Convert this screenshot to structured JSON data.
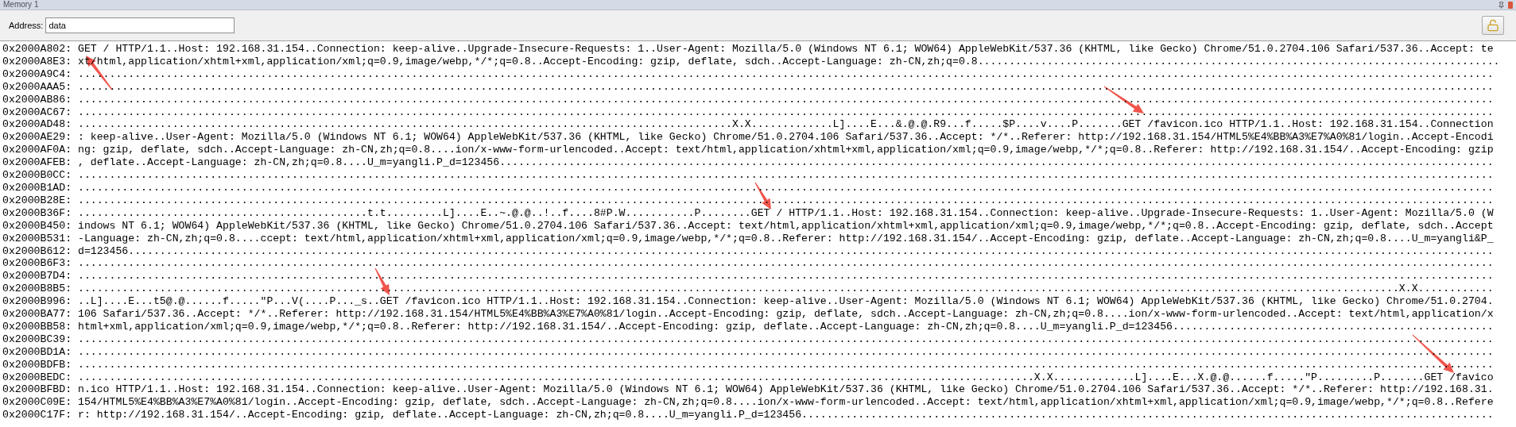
{
  "panel": {
    "title": "Memory 1"
  },
  "address_bar": {
    "label": "Address:",
    "value": "data"
  },
  "rows": [
    {
      "address": "0x2000A802:",
      "text": "GET / HTTP/1.1..Host: 192.168.31.154..Connection: keep-alive..Upgrade-Insecure-Requests: 1..User-Agent: Mozilla/5.0 (Windows NT 6.1; WOW64) AppleWebKit/537.36 (KHTML, like Gecko) Chrome/51.0.2704.106 Safari/537.36..Accept: te"
    },
    {
      "address": "0x2000A8E3:",
      "text": "xt/html,application/xhtml+xml,application/xml;q=0.9,image/webp,*/*;q=0.8..Accept-Encoding: gzip, deflate, sdch..Accept-Language: zh-CN,zh;q=0.8..................................................................................."
    },
    {
      "address": "0x2000A9C4:",
      "text": "................................................................................................................................................................................................................................."
    },
    {
      "address": "0x2000AAA5:",
      "text": "................................................................................................................................................................................................................................."
    },
    {
      "address": "0x2000AB86:",
      "text": "................................................................................................................................................................................................................................."
    },
    {
      "address": "0x2000AC67:",
      "text": "................................................................................................................................................................................................................................."
    },
    {
      "address": "0x2000AD48:",
      "text": "........................................................................................................X.X.............L]....E...&.@.@.R9...f.....$P....v....P.......GET /favicon.ico HTTP/1.1..Host: 192.168.31.154..Connection"
    },
    {
      "address": "0x2000AE29:",
      "text": ": keep-alive..User-Agent: Mozilla/5.0 (Windows NT 6.1; WOW64) AppleWebKit/537.36 (KHTML, like Gecko) Chrome/51.0.2704.106 Safari/537.36..Accept: */*..Referer: http://192.168.31.154/HTML5%E4%BB%A3%E7%A0%81/login..Accept-Encodi"
    },
    {
      "address": "0x2000AF0A:",
      "text": "ng: gzip, deflate, sdch..Accept-Language: zh-CN,zh;q=0.8....ion/x-www-form-urlencoded..Accept: text/html,application/xhtml+xml,application/xml;q=0.9,image/webp,*/*;q=0.8..Referer: http://192.168.31.154/..Accept-Encoding: gzip"
    },
    {
      "address": "0x2000AFEB:",
      "text": ", deflate..Accept-Language: zh-CN,zh;q=0.8....U_m=yangli.P_d=123456.............................................................................................................................................................."
    },
    {
      "address": "0x2000B0CC:",
      "text": "................................................................................................................................................................................................................................."
    },
    {
      "address": "0x2000B1AD:",
      "text": "................................................................................................................................................................................................................................."
    },
    {
      "address": "0x2000B28E:",
      "text": "................................................................................................................................................................................................................................."
    },
    {
      "address": "0x2000B36F:",
      "text": "..............................................t.t.........L]....E..~.@.@..!..f....8#P.W...........P........GET / HTTP/1.1..Host: 192.168.31.154..Connection: keep-alive..Upgrade-Insecure-Requests: 1..User-Agent: Mozilla/5.0 (W"
    },
    {
      "address": "0x2000B450:",
      "text": "indows NT 6.1; WOW64) AppleWebKit/537.36 (KHTML, like Gecko) Chrome/51.0.2704.106 Safari/537.36..Accept: text/html,application/xhtml+xml,application/xml;q=0.9,image/webp,*/*;q=0.8..Accept-Encoding: gzip, deflate, sdch..Accept"
    },
    {
      "address": "0x2000B531:",
      "text": "-Language: zh-CN,zh;q=0.8....ccept: text/html,application/xhtml+xml,application/xml;q=0.9,image/webp,*/*;q=0.8..Referer: http://192.168.31.154/..Accept-Encoding: gzip, deflate..Accept-Language: zh-CN,zh;q=0.8....U_m=yangli&P_"
    },
    {
      "address": "0x2000B612:",
      "text": "d=123456........................................................................................................................................................................................................................."
    },
    {
      "address": "0x2000B6F3:",
      "text": "................................................................................................................................................................................................................................."
    },
    {
      "address": "0x2000B7D4:",
      "text": "................................................................................................................................................................................................................................."
    },
    {
      "address": "0x2000B8B5:",
      "text": "..................................................................................................................................................................................................................X.X............"
    },
    {
      "address": "0x2000B996:",
      "text": "..L]....E...t5@.@......f.....\"P...V(....P..._s..GET /favicon.ico HTTP/1.1..Host: 192.168.31.154..Connection: keep-alive..User-Agent: Mozilla/5.0 (Windows NT 6.1; WOW64) AppleWebKit/537.36 (KHTML, like Gecko) Chrome/51.0.2704."
    },
    {
      "address": "0x2000BA77:",
      "text": "106 Safari/537.36..Accept: */*..Referer: http://192.168.31.154/HTML5%E4%BB%A3%E7%A0%81/login..Accept-Encoding: gzip, deflate, sdch..Accept-Language: zh-CN,zh;q=0.8....ion/x-www-form-urlencoded..Accept: text/html,application/x"
    },
    {
      "address": "0x2000BB58:",
      "text": "html+xml,application/xml;q=0.9,image/webp,*/*;q=0.8..Referer: http://192.168.31.154/..Accept-Encoding: gzip, deflate..Accept-Language: zh-CN,zh;q=0.8....U_m=yangli.P_d=123456..................................................."
    },
    {
      "address": "0x2000BC39:",
      "text": "................................................................................................................................................................................................................................."
    },
    {
      "address": "0x2000BD1A:",
      "text": "................................................................................................................................................................................................................................."
    },
    {
      "address": "0x2000BDFB:",
      "text": "................................................................................................................................................................................................................................."
    },
    {
      "address": "0x2000BEDC:",
      "text": "........................................................................................................................................................X.X.............L]....E...X.@.@......f.....\"P.........P.......GET /favico"
    },
    {
      "address": "0x2000BFBD:",
      "text": "n.ico HTTP/1.1..Host: 192.168.31.154..Connection: keep-alive..User-Agent: Mozilla/5.0 (Windows NT 6.1; WOW64) AppleWebKit/537.36 (KHTML, like Gecko) Chrome/51.0.2704.106 Safari/537.36..Accept: */*..Referer: http://192.168.31."
    },
    {
      "address": "0x2000C09E:",
      "text": "154/HTML5%E4%BB%A3%E7%A0%81/login..Accept-Encoding: gzip, deflate, sdch..Accept-Language: zh-CN,zh;q=0.8....ion/x-www-form-urlencoded..Accept: text/html,application/xhtml+xml,application/xml;q=0.9,image/webp,*/*;q=0.8..Refere"
    },
    {
      "address": "0x2000C17F:",
      "text": "r: http://192.168.31.154/..Accept-Encoding: gzip, deflate..Accept-Language: zh-CN,zh;q=0.8....U_m=yangli.P_d=123456.............................................................................................................."
    }
  ]
}
